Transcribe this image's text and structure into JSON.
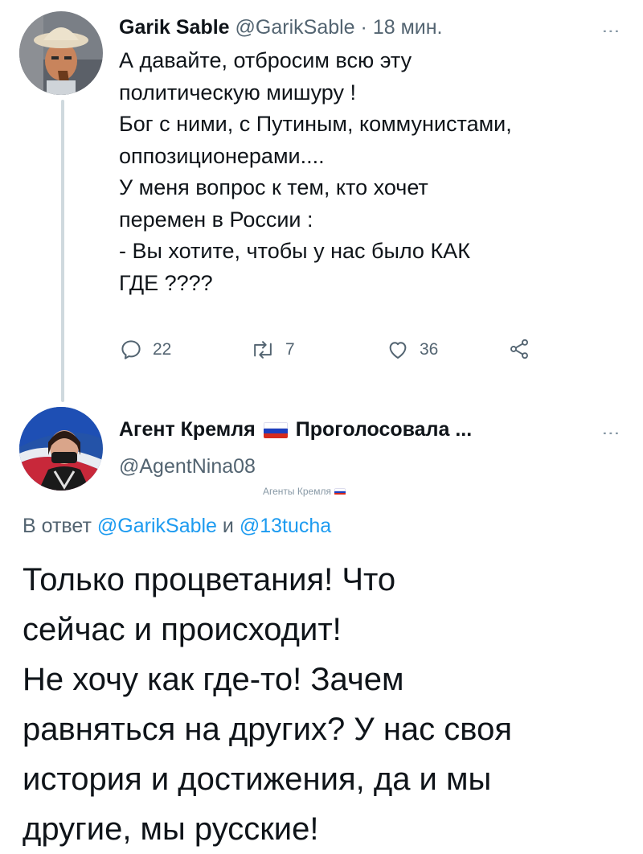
{
  "tweet1": {
    "display_name": "Garik Sable",
    "handle": "@GarikSable",
    "separator": "·",
    "time": "18 мин.",
    "body_lines": [
      "А давайте, отбросим всю эту",
      "политическую мишуру !",
      "Бог с ними, с Путиным, коммунистами,",
      "оппозиционерами....",
      "У меня вопрос к тем, кто хочет",
      "перемен в России :",
      "- Вы хотите, чтобы у нас было КАК",
      "ГДЕ ????"
    ],
    "replies": "22",
    "retweets": "7",
    "likes": "36"
  },
  "tweet2": {
    "display_name": "Агент Кремля",
    "name_suffix": "Проголосовала ...",
    "handle": "@AgentNina08",
    "badge_text": "Агенты Кремля",
    "reply_prefix": "В ответ",
    "reply_user1": "@GarikSable",
    "reply_joiner": "и",
    "reply_user2": "@13tucha",
    "body_lines": [
      "Только процветания! Что",
      "сейчас и происходит!",
      "Не хочу как где-то! Зачем",
      "равняться на других? У нас своя",
      "история и достижения, да и мы",
      "другие, мы русские!"
    ]
  },
  "colors": {
    "link": "#1d9bf0",
    "muted": "#536471",
    "text": "#0f1419",
    "thread_line": "#cfd9de"
  },
  "icons": [
    "reply-icon",
    "retweet-icon",
    "like-icon",
    "share-icon",
    "more-icon",
    "russian-flag-icon"
  ]
}
